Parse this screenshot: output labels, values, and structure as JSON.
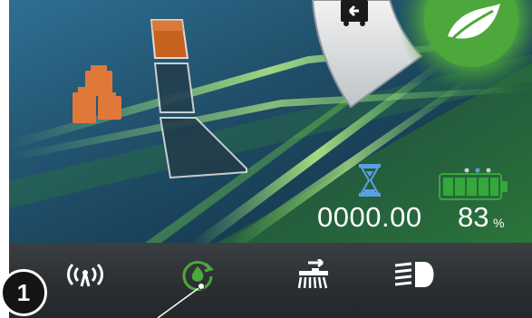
{
  "screen": {
    "timer": {
      "value": "0000.00",
      "icon": "hourglass-icon"
    },
    "battery": {
      "percent": 83,
      "value": "83",
      "unit": "%",
      "bars_filled": 5,
      "bars_total": 5,
      "icon": "battery-icon"
    },
    "page_indicator": {
      "count": 3,
      "active_index": 1
    },
    "mode": {
      "icon": "eco-leaf-icon"
    },
    "trailer_indicator": {
      "icon": "trailer-mode-icon"
    },
    "ballast_indicator": {
      "icon": "weights-icon",
      "level_segments": 3,
      "active_segment": 0
    }
  },
  "toolbar": {
    "items": [
      {
        "name": "antenna",
        "icon": "antenna-icon"
      },
      {
        "name": "eco-refresh",
        "icon": "eco-refresh-icon"
      },
      {
        "name": "sweeper",
        "icon": "sweeper-icon"
      },
      {
        "name": "headlight",
        "icon": "headlight-icon"
      }
    ]
  },
  "annotation": {
    "step_number": "1"
  },
  "colors": {
    "accent_orange": "#e0783a",
    "eco_green": "#4ca83a",
    "battery_green": "#35a83a",
    "hourglass_blue": "#5aa0e6"
  }
}
